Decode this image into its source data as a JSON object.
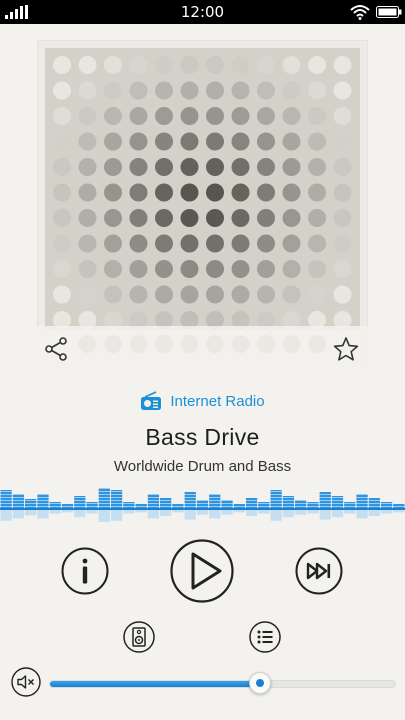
{
  "status_bar": {
    "time": "12:00",
    "icons": [
      "signal-icon",
      "wifi-icon",
      "battery-icon"
    ]
  },
  "player": {
    "source_label": "Internet Radio",
    "station_name": "Bass Drive",
    "station_description": "Worldwide Drum and Bass",
    "volume_fraction": 0.61
  },
  "actions": {
    "share_icon": "share-icon",
    "favorite_icon": "star-icon",
    "info_icon": "info-icon",
    "play_icon": "play-icon",
    "next_icon": "fast-forward-icon",
    "speaker_icon": "speaker-icon",
    "list_icon": "list-icon",
    "mute_icon": "mute-icon"
  },
  "colors": {
    "accent": "#1d8fd6",
    "background": "#f3f2ee",
    "status_bar": "#000000",
    "icon_stroke": "#222222"
  }
}
